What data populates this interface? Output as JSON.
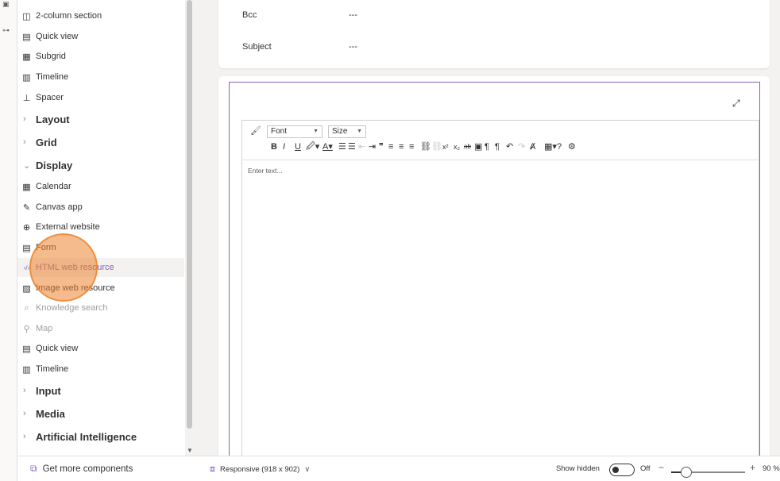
{
  "rail": {
    "icons": [
      "element-icon",
      "connector-icon"
    ]
  },
  "panel": {
    "rows": [
      {
        "kind": "item",
        "label": "2-column section",
        "icon": "two-column-icon",
        "glyph": "◫",
        "state": "normal"
      },
      {
        "kind": "item",
        "label": "Quick view",
        "icon": "quick-view-icon",
        "glyph": "▤",
        "state": "normal"
      },
      {
        "kind": "item",
        "label": "Subgrid",
        "icon": "subgrid-icon",
        "glyph": "▦",
        "state": "normal"
      },
      {
        "kind": "item",
        "label": "Timeline",
        "icon": "timeline-icon",
        "glyph": "▥",
        "state": "normal"
      },
      {
        "kind": "item",
        "label": "Spacer",
        "icon": "spacer-icon",
        "glyph": "⊥",
        "state": "normal"
      },
      {
        "kind": "group",
        "label": "Layout",
        "chevron": "›",
        "expanded": false
      },
      {
        "kind": "group",
        "label": "Grid",
        "chevron": "›",
        "expanded": false
      },
      {
        "kind": "group",
        "label": "Display",
        "chevron": "⌄",
        "expanded": true
      },
      {
        "kind": "item",
        "label": "Calendar",
        "icon": "calendar-icon",
        "glyph": "▦",
        "state": "normal"
      },
      {
        "kind": "item",
        "label": "Canvas app",
        "icon": "canvas-app-icon",
        "glyph": "✎",
        "state": "normal"
      },
      {
        "kind": "item",
        "label": "External website",
        "icon": "globe-icon",
        "glyph": "⊕",
        "state": "normal"
      },
      {
        "kind": "item",
        "label": "Form",
        "icon": "form-icon",
        "glyph": "▤",
        "state": "normal"
      },
      {
        "kind": "item",
        "label": "HTML web resource",
        "icon": "html-code-icon",
        "glyph": "‹/›",
        "state": "selected"
      },
      {
        "kind": "item",
        "label": "Image web resource",
        "icon": "image-icon",
        "glyph": "▨",
        "state": "normal"
      },
      {
        "kind": "item",
        "label": "Knowledge search",
        "icon": "knowledge-search-icon",
        "glyph": "⌕",
        "state": "disabled"
      },
      {
        "kind": "item",
        "label": "Map",
        "icon": "map-icon",
        "glyph": "⚲",
        "state": "disabled"
      },
      {
        "kind": "item",
        "label": "Quick view",
        "icon": "quick-view-icon",
        "glyph": "▤",
        "state": "normal"
      },
      {
        "kind": "item",
        "label": "Timeline",
        "icon": "timeline-icon",
        "glyph": "▥",
        "state": "normal"
      },
      {
        "kind": "group",
        "label": "Input",
        "chevron": "›",
        "expanded": false
      },
      {
        "kind": "group",
        "label": "Media",
        "chevron": "›",
        "expanded": false
      },
      {
        "kind": "group",
        "label": "Artificial Intelligence",
        "chevron": "›",
        "expanded": false
      }
    ],
    "footer_label": "Get more components"
  },
  "form": {
    "fields": [
      {
        "label": "Bcc",
        "value": "---"
      },
      {
        "label": "Subject",
        "value": "---"
      }
    ]
  },
  "editor": {
    "font_label": "Font",
    "size_label": "Size",
    "placeholder": "Enter text...",
    "tools": [
      {
        "name": "bold",
        "glyph": "B"
      },
      {
        "name": "italic",
        "glyph": "I"
      },
      {
        "name": "underline",
        "glyph": "U"
      },
      {
        "name": "highlight",
        "glyph": "🖉▾"
      },
      {
        "name": "font-color",
        "glyph": "A▾"
      },
      {
        "name": "numbered-list",
        "glyph": "☰"
      },
      {
        "name": "bulleted-list",
        "glyph": "☰"
      },
      {
        "name": "decrease-indent",
        "glyph": "⇤",
        "faded": true
      },
      {
        "name": "increase-indent",
        "glyph": "⇥"
      },
      {
        "name": "blockquote",
        "glyph": "❞"
      },
      {
        "name": "align-left",
        "glyph": "≡"
      },
      {
        "name": "align-center",
        "glyph": "≡"
      },
      {
        "name": "align-right",
        "glyph": "≡"
      },
      {
        "name": "link",
        "glyph": "⛓"
      },
      {
        "name": "unlink",
        "glyph": "⛓",
        "faded": true
      },
      {
        "name": "superscript",
        "glyph": "x²"
      },
      {
        "name": "subscript",
        "glyph": "x₂"
      },
      {
        "name": "strikethrough",
        "glyph": "ab"
      },
      {
        "name": "image",
        "glyph": "▣"
      },
      {
        "name": "ltr",
        "glyph": "¶"
      },
      {
        "name": "rtl",
        "glyph": "¶"
      },
      {
        "name": "undo",
        "glyph": "↶"
      },
      {
        "name": "redo",
        "glyph": "↷",
        "faded": true
      },
      {
        "name": "clear-format",
        "glyph": "Ⱥ"
      },
      {
        "name": "table",
        "glyph": "▦▾"
      },
      {
        "name": "help",
        "glyph": "?"
      },
      {
        "name": "settings",
        "glyph": "⚙"
      }
    ]
  },
  "status": {
    "layout_label": "Responsive (918 x 902)",
    "layout_caret": "∨",
    "show_hidden_label": "Show hidden",
    "toggle_state": "Off",
    "zoom_label": "90 %",
    "zoom_fraction": 0.2
  },
  "colors": {
    "accent": "#8764b8",
    "click_indicator": "#ec842d"
  }
}
